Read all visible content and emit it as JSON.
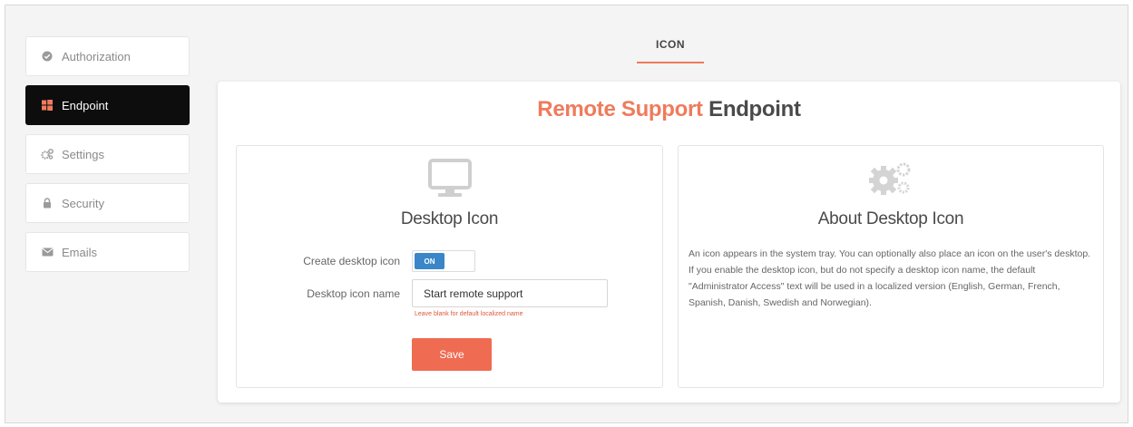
{
  "sidebar": {
    "items": [
      {
        "label": "Authorization",
        "icon": "check-circle-icon",
        "active": false
      },
      {
        "label": "Endpoint",
        "icon": "windows-icon",
        "active": true
      },
      {
        "label": "Settings",
        "icon": "gears-icon",
        "active": false
      },
      {
        "label": "Security",
        "icon": "lock-icon",
        "active": false
      },
      {
        "label": "Emails",
        "icon": "envelope-icon",
        "active": false
      }
    ]
  },
  "tabs": [
    {
      "label": "ICON",
      "active": true
    }
  ],
  "main": {
    "title_accent": "Remote Support",
    "title_rest": "Endpoint",
    "left_panel": {
      "icon": "desktop-icon",
      "title": "Desktop Icon",
      "create_label": "Create desktop icon",
      "toggle_text": "ON",
      "name_label": "Desktop icon name",
      "name_value": "Start remote support",
      "hint": "Leave blank for default localized name",
      "save_label": "Save"
    },
    "right_panel": {
      "icon": "gears-icon",
      "title": "About Desktop Icon",
      "text": "An icon appears in the system tray. You can optionally also place an icon on the user's desktop. If you enable the desktop icon, but do not specify a desktop icon name, the default \"Administrator Access\" text will be used in a localized version (English, German, French, Spanish, Danish, Swedish and Norwegian)."
    }
  },
  "colors": {
    "accent": "#ef7b5c",
    "active_sidebar_bg": "#0d0d0d",
    "toggle_on": "#3a86c8",
    "save_button": "#ef6b52",
    "hint_text": "#e0573a"
  }
}
